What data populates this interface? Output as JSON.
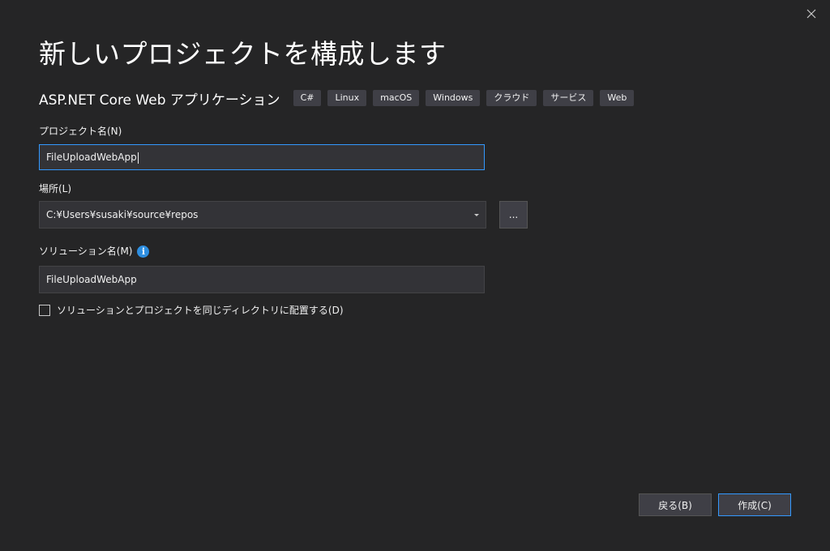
{
  "dialog": {
    "title": "新しいプロジェクトを構成します",
    "close_icon": "close-icon"
  },
  "template": {
    "name": "ASP.NET Core Web アプリケーション",
    "tags": [
      "C#",
      "Linux",
      "macOS",
      "Windows",
      "クラウド",
      "サービス",
      "Web"
    ]
  },
  "project_name": {
    "label": "プロジェクト名(N)",
    "value": "FileUploadWebApp"
  },
  "location": {
    "label": "場所(L)",
    "value": "C:¥Users¥susaki¥source¥repos",
    "browse_label": "..."
  },
  "solution_name": {
    "label": "ソリューション名(M)",
    "info_glyph": "i",
    "value": "FileUploadWebApp"
  },
  "same_directory": {
    "label": "ソリューションとプロジェクトを同じディレクトリに配置する(D)",
    "checked": false
  },
  "footer": {
    "back_label": "戻る(B)",
    "create_label": "作成(C)"
  },
  "colors": {
    "background": "#252526",
    "input_bg": "#333337",
    "focus_border": "#3399ff",
    "tag_bg": "#3f3f46",
    "info_blue": "#2d8ee0"
  }
}
